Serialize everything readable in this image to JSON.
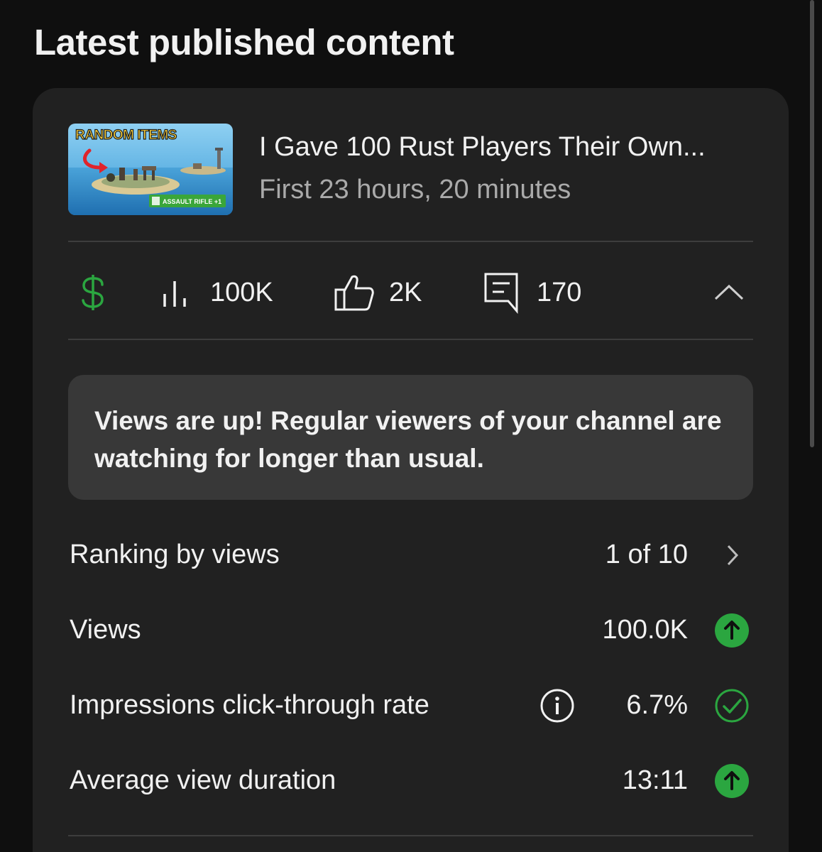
{
  "section": {
    "title": "Latest published content"
  },
  "video": {
    "title": "I Gave 100 Rust Players Their Own...",
    "subtitle": "First 23 hours, 20 minutes",
    "thumbnail": {
      "banner_text": "RANDOM ITEMS",
      "badge_text": "ASSAULT RIFLE +1"
    }
  },
  "stats": {
    "monetization_icon": "dollar-icon",
    "views": "100K",
    "likes": "2K",
    "comments": "170",
    "collapse_icon": "chevron-up-icon"
  },
  "insight": {
    "text": "Views are up! Regular viewers of your channel are watching for longer than usual."
  },
  "metrics": [
    {
      "label": "Ranking by views",
      "value": "1 of 10",
      "icon": "chevron-right-icon"
    },
    {
      "label": "Views",
      "value": "100.0K",
      "icon": "arrow-up-circle-icon"
    },
    {
      "label": "Impressions click-through rate",
      "value": "6.7%",
      "icon": "check-circle-icon",
      "info_icon": "info-icon"
    },
    {
      "label": "Average view duration",
      "value": "13:11",
      "icon": "arrow-up-circle-icon"
    }
  ],
  "colors": {
    "background": "#0f0f0f",
    "card": "#212121",
    "insight_box": "#383838",
    "accent_green": "#2ba640",
    "text_primary": "#f1f1f1",
    "text_secondary": "#aaaaaa"
  }
}
